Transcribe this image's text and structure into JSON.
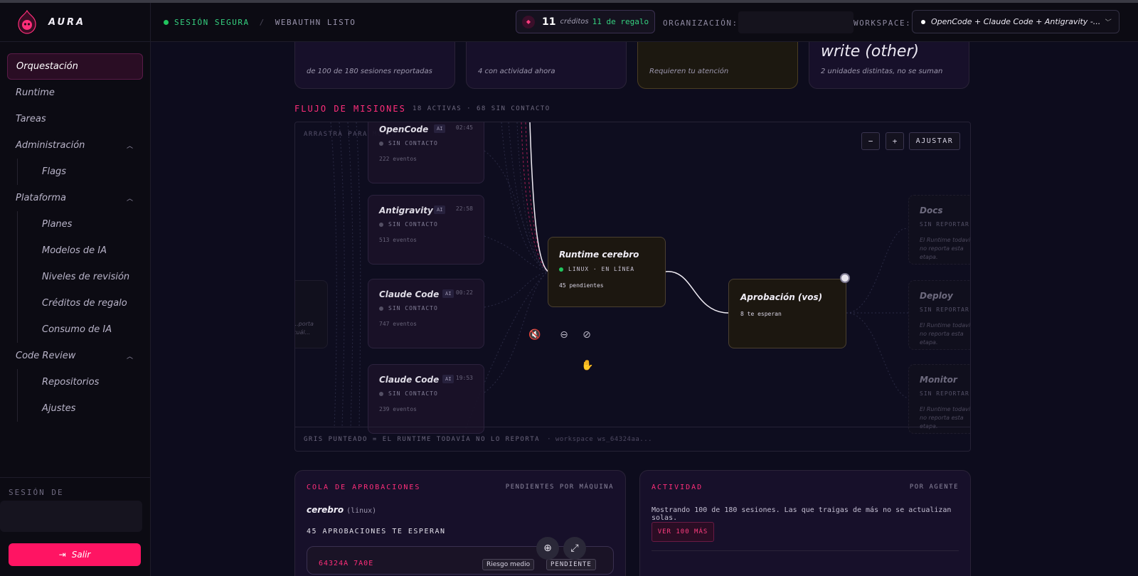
{
  "brand": {
    "name": "AURA"
  },
  "header": {
    "secure": "SESIÓN SEGURA",
    "separator": "/",
    "webauthn": "WEBAUTHN LISTO",
    "credits": {
      "count": "11",
      "label": "créditos",
      "gift": "11 de regalo"
    },
    "org_label": "ORGANIZACIÓN:",
    "workspace_label": "WORKSPACE:",
    "workspace_value": "OpenCode + Claude Code + Antigravity -..."
  },
  "sidebar": {
    "items": [
      {
        "label": "Orquestación"
      },
      {
        "label": "Runtime"
      },
      {
        "label": "Tareas"
      },
      {
        "label": "Administración"
      },
      {
        "label": "Flags"
      },
      {
        "label": "Plataforma"
      },
      {
        "label": "Planes"
      },
      {
        "label": "Modelos de IA"
      },
      {
        "label": "Niveles de revisión"
      },
      {
        "label": "Créditos de regalo"
      },
      {
        "label": "Consumo de IA"
      },
      {
        "label": "Code Review"
      },
      {
        "label": "Repositorios"
      },
      {
        "label": "Ajustes"
      }
    ],
    "session_label": "SESIÓN DE",
    "logout": "Salir"
  },
  "stats": [
    {
      "big": "",
      "small": "de 100 de 180 sesiones reportadas"
    },
    {
      "big": "",
      "small": "4 con actividad ahora"
    },
    {
      "big": "",
      "small": "Requieren tu atención"
    },
    {
      "big": "write (other)",
      "small": "2 unidades distintas, no se suman"
    }
  ],
  "flow": {
    "title": "FLUJO DE MISIONES",
    "subtitle": "18 ACTIVAS · 68 SIN CONTACTO",
    "hint": "ARRASTRA PARA MOVER",
    "zoom_out": "−",
    "zoom_in": "+",
    "fit": "AJUSTAR",
    "footer": "GRIS PUNTEADO = EL RUNTIME TODAVÍA NO LO REPORTA",
    "footer_ws": "· workspace ws_64324aa...",
    "agents": [
      {
        "name": "OpenCode",
        "badge": "AI",
        "time": "02:45",
        "status": "SIN CONTACTO",
        "events": "222 eventos"
      },
      {
        "name": "Antigravity",
        "badge": "AI",
        "time": "22:58",
        "status": "SIN CONTACTO",
        "events": "513 eventos"
      },
      {
        "name": "Claude Code",
        "badge": "AI",
        "time": "00:22",
        "status": "SIN CONTACTO",
        "events": "747 eventos"
      },
      {
        "name": "Claude Code",
        "badge": "AI",
        "time": "19:53",
        "status": "SIN CONTACTO",
        "events": "239 eventos"
      }
    ],
    "runtime": {
      "name": "Runtime cerebro",
      "status": "LINUX · EN LÍNEA",
      "pending": "45 pendientes"
    },
    "approval": {
      "name": "Aprobación (vos)",
      "waiting": "8 te esperan"
    },
    "stages": [
      {
        "name": "Docs",
        "status": "SIN REPORTAR",
        "desc": "El Runtime todavía no reporta esta etapa."
      },
      {
        "name": "Deploy",
        "status": "SIN REPORTAR",
        "desc": "El Runtime todavía no reporta esta etapa."
      },
      {
        "name": "Monitor",
        "status": "SIN REPORTAR",
        "desc": "El Runtime todavía no reporta esta etapa."
      }
    ],
    "left_stub": "...porta cuál..."
  },
  "queue": {
    "title": "COLA DE APROBACIONES",
    "meta": "PENDIENTES POR MÁQUINA",
    "host": "cerebro",
    "os": "(linux)",
    "count": "45 APROBACIONES TE ESPERAN",
    "item_id": "64324A 7A0E",
    "risk": "Riesgo medio",
    "state": "PENDIENTE"
  },
  "activity": {
    "title": "ACTIVIDAD",
    "meta": "POR AGENTE",
    "text": "Mostrando 100 de 180 sesiones. Las que traigas de más no se actualizan solas.",
    "button": "VER 100 MÁS"
  }
}
